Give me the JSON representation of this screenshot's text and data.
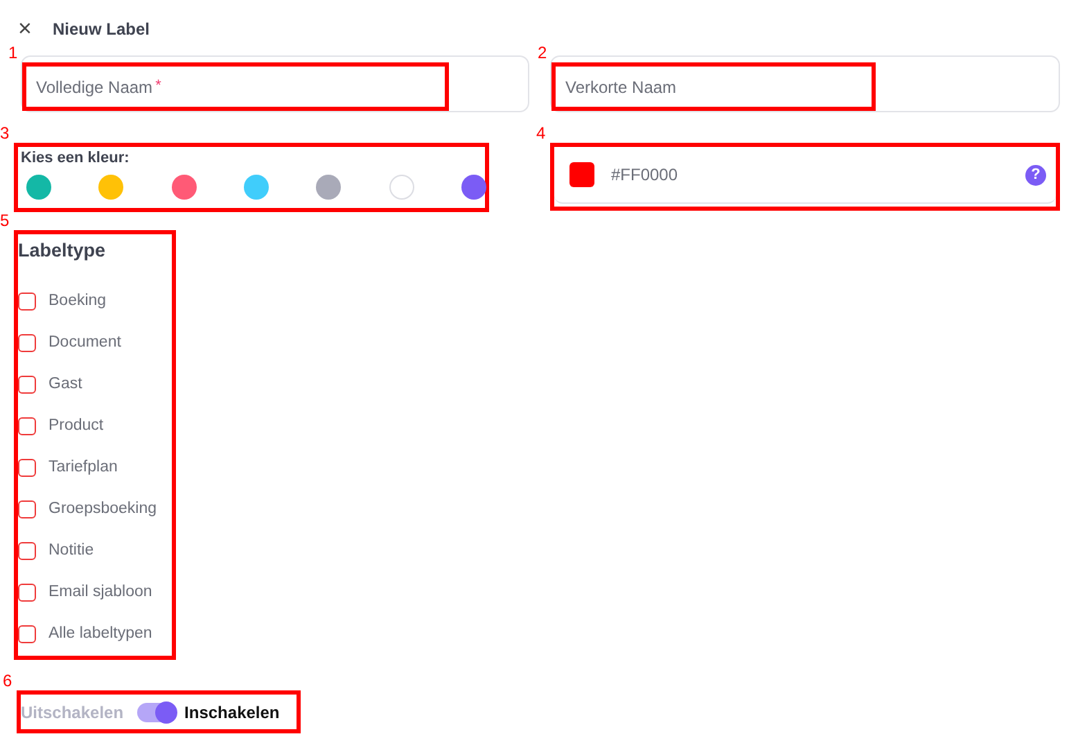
{
  "header": {
    "close_icon": "×",
    "title": "Nieuw Label"
  },
  "full_name_field": {
    "placeholder": "Volledige Naam",
    "required_mark": "*",
    "annotation": "1"
  },
  "short_name_field": {
    "placeholder": "Verkorte Naam",
    "annotation": "2"
  },
  "color_picker": {
    "label": "Kies een kleur:",
    "annotation": "3",
    "swatches": [
      {
        "color": "#14b8a6"
      },
      {
        "color": "#ffc107"
      },
      {
        "color": "#ff5a76"
      },
      {
        "color": "#40cdfb"
      },
      {
        "color": "#a9aab8"
      },
      {
        "color": "#ffffff"
      },
      {
        "color": "#7b5cf5"
      }
    ]
  },
  "color_field": {
    "color": "#ff0000",
    "value": "#FF0000",
    "help_icon": "?",
    "annotation": "4"
  },
  "label_types": {
    "title": "Labeltype",
    "annotation": "5",
    "items": [
      {
        "label": "Boeking",
        "checked": false
      },
      {
        "label": "Document",
        "checked": false
      },
      {
        "label": "Gast",
        "checked": false
      },
      {
        "label": "Product",
        "checked": false
      },
      {
        "label": "Tariefplan",
        "checked": false
      },
      {
        "label": "Groepsboeking",
        "checked": false
      },
      {
        "label": "Notitie",
        "checked": false
      },
      {
        "label": "Email sjabloon",
        "checked": false
      },
      {
        "label": "Alle labeltypen",
        "checked": false
      }
    ]
  },
  "status_toggle": {
    "off_label": "Uitschakelen",
    "on_label": "Inschakelen",
    "on": true,
    "annotation": "6"
  }
}
